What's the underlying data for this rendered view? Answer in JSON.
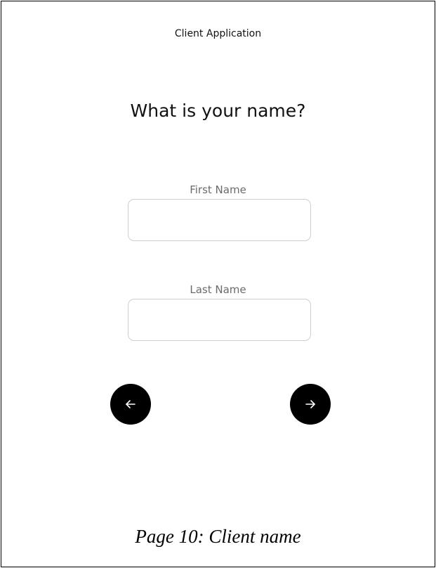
{
  "header": {
    "title": "Client Application"
  },
  "main": {
    "question": "What is your name?",
    "fields": [
      {
        "label": "First Name",
        "value": "",
        "placeholder": ""
      },
      {
        "label": "Last Name",
        "value": "",
        "placeholder": ""
      }
    ],
    "navigation": {
      "back_icon": "arrow-left-icon",
      "next_icon": "arrow-right-icon"
    }
  },
  "caption": "Page 10: Client name",
  "colors": {
    "button_background": "#000000",
    "field_border": "#cfcfcf",
    "label_text": "#6b6b6b"
  }
}
